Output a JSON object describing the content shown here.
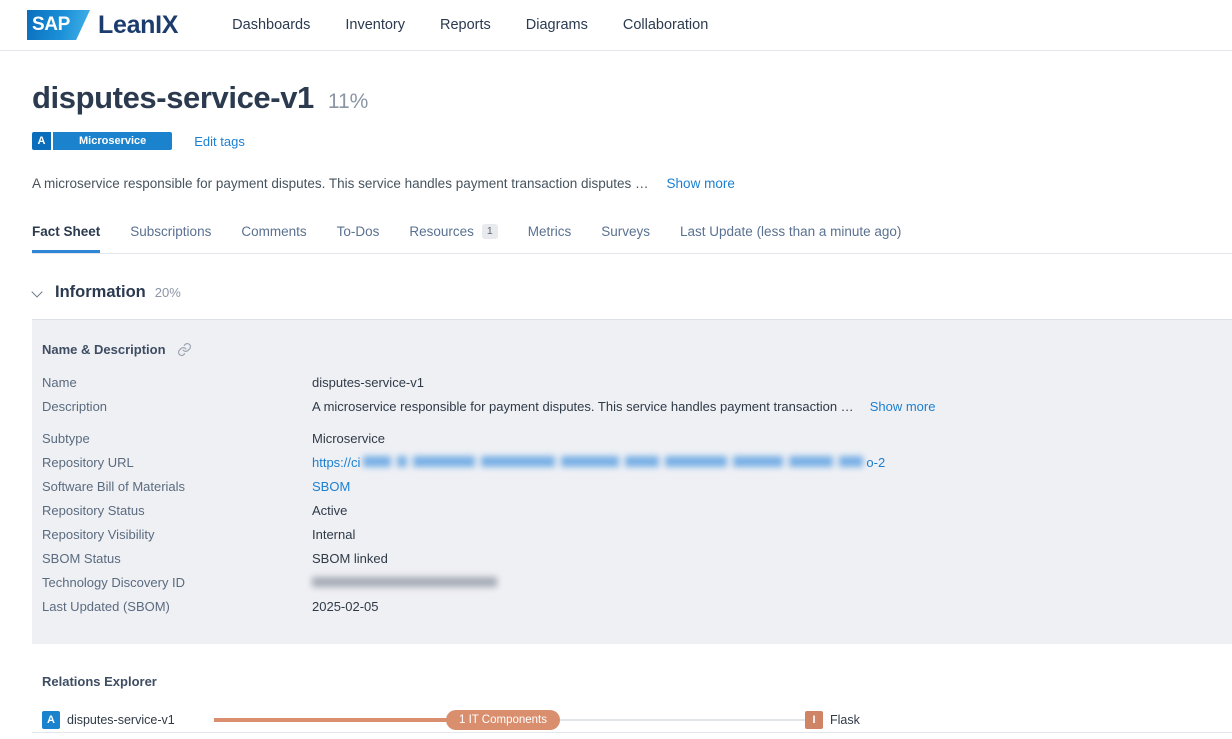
{
  "topbar": {
    "logo_mark_text": "SAP",
    "brand_name": "LeanIX",
    "nav": [
      {
        "label": "Dashboards"
      },
      {
        "label": "Inventory"
      },
      {
        "label": "Reports"
      },
      {
        "label": "Diagrams"
      },
      {
        "label": "Collaboration"
      }
    ]
  },
  "header": {
    "title": "disputes-service-v1",
    "completion": "11%",
    "tag_letter": "A",
    "tag_label": "Microservice",
    "edit_tags": "Edit tags",
    "description": "A microservice responsible for payment disputes. This service handles payment transaction disputes …",
    "show_more": "Show more"
  },
  "tabs": [
    {
      "label": "Fact Sheet",
      "active": true,
      "badge": ""
    },
    {
      "label": "Subscriptions",
      "active": false,
      "badge": ""
    },
    {
      "label": "Comments",
      "active": false,
      "badge": ""
    },
    {
      "label": "To-Dos",
      "active": false,
      "badge": ""
    },
    {
      "label": "Resources",
      "active": false,
      "badge": "1"
    },
    {
      "label": "Metrics",
      "active": false,
      "badge": ""
    },
    {
      "label": "Surveys",
      "active": false,
      "badge": ""
    },
    {
      "label": "Last Update (less than a minute ago)",
      "active": false,
      "badge": ""
    }
  ],
  "information": {
    "section_title": "Information",
    "section_percent": "20%",
    "card_title": "Name & Description",
    "fields": [
      {
        "label": "Name",
        "value": "disputes-service-v1"
      },
      {
        "label": "Description",
        "value": "A microservice responsible for payment disputes. This service handles payment transaction …",
        "action": "Show more"
      },
      {
        "label": "Subtype",
        "value": "Microservice"
      },
      {
        "label": "Repository URL",
        "value": "https://ci",
        "value_suffix": "o-2",
        "redacted": true
      },
      {
        "label": "Software Bill of Materials",
        "value": "SBOM",
        "link": true
      },
      {
        "label": "Repository Status",
        "value": "Active"
      },
      {
        "label": "Repository Visibility",
        "value": "Internal"
      },
      {
        "label": "SBOM Status",
        "value": "SBOM linked"
      },
      {
        "label": "Technology Discovery ID",
        "value": "",
        "redacted_gray": true
      },
      {
        "label": "Last Updated (SBOM)",
        "value": "2025-02-05"
      }
    ]
  },
  "relations": {
    "title": "Relations Explorer",
    "source": {
      "badge": "A",
      "label": "disputes-service-v1"
    },
    "edge_pill": "1 IT Components",
    "target": {
      "badge": "I",
      "label": "Flask"
    }
  },
  "colors": {
    "accent_blue": "#1b7fd1",
    "tag_blue": "#1b82ce",
    "tag_blue_dark": "#0a6ebd",
    "relation_salmon": "#d98e6e",
    "card_bg": "#eff0f4",
    "text_dark": "#2b3a4f"
  }
}
